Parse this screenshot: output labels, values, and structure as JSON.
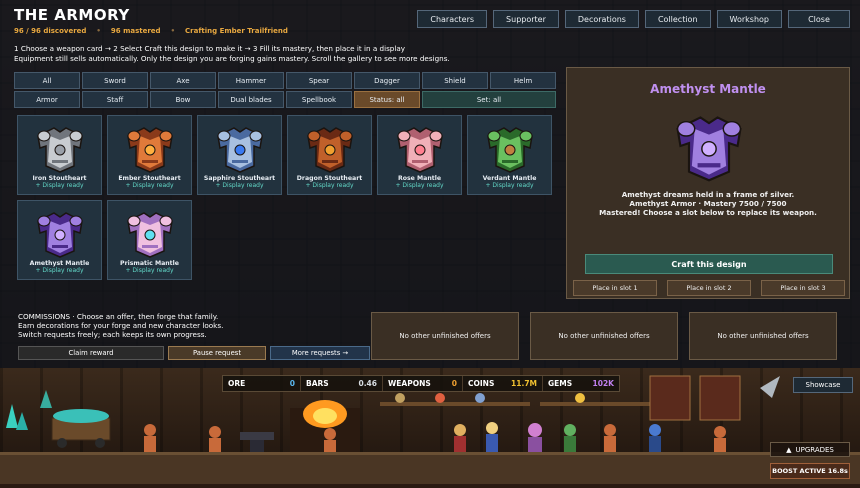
{
  "header": {
    "title": "THE ARMORY",
    "discovered": "96 / 96 discovered",
    "mastered": "96 mastered",
    "crafting": "Crafting Ember Trailfriend",
    "separator": "•"
  },
  "nav": [
    "Characters",
    "Supporter",
    "Decorations",
    "Collection",
    "Workshop",
    "Close"
  ],
  "instructions": {
    "line1": "1  Choose a weapon card      →      2  Select Craft this design to make it      →      3  Fill its mastery, then place it in a display",
    "line2": "Equipment still sells automatically. Only the design you are forging gains mastery. Scroll the gallery to see more designs."
  },
  "filters": {
    "row1": [
      "All",
      "Sword",
      "Axe",
      "Hammer",
      "Spear",
      "Dagger",
      "Shield",
      "Helm"
    ],
    "row2": [
      "Armor",
      "Staff",
      "Bow",
      "Dual blades",
      "Spellbook",
      "Status: all",
      "Set: all"
    ]
  },
  "cards": [
    {
      "name": "Iron Stoutheart",
      "status": "+ Display ready",
      "c1": "#c8ccd0",
      "c2": "#70757c",
      "gem": "#9aa0a8"
    },
    {
      "name": "Ember Stoutheart",
      "status": "+ Display ready",
      "c1": "#e07a3a",
      "c2": "#8a3a1a",
      "gem": "#ffb040"
    },
    {
      "name": "Sapphire Stoutheart",
      "status": "+ Display ready",
      "c1": "#a8c0e0",
      "c2": "#4a6aa0",
      "gem": "#3a7af0"
    },
    {
      "name": "Dragon Stoutheart",
      "status": "+ Display ready",
      "c1": "#c0602a",
      "c2": "#6a2a14",
      "gem": "#f0a030"
    },
    {
      "name": "Rose Mantle",
      "status": "+ Display ready",
      "c1": "#f0b0b8",
      "c2": "#b06070",
      "gem": "#ff8090"
    },
    {
      "name": "Verdant Mantle",
      "status": "+ Display ready",
      "c1": "#6ac060",
      "c2": "#2a6a2a",
      "gem": "#c08040"
    },
    {
      "name": "Amethyst Mantle",
      "status": "+ Display ready",
      "c1": "#a080e0",
      "c2": "#4a2a8a",
      "gem": "#d0b0ff"
    },
    {
      "name": "Prismatic Mantle",
      "status": "+ Display ready",
      "c1": "#f0c0e0",
      "c2": "#a070c0",
      "gem": "#60e0f0"
    }
  ],
  "detail": {
    "name": "Amethyst Mantle",
    "line1": "Amethyst dreams held in a frame of silver.",
    "line2": "Amethyst Armor · Mastery 7500 / 7500",
    "line3": "Mastered! Choose a slot below to replace its weapon.",
    "craft": "Craft this design",
    "slots": [
      "Place in slot 1",
      "Place in slot 2",
      "Place in slot 3"
    ]
  },
  "commissions": {
    "line1": "COMMISSIONS · Choose an offer, then forge that family.",
    "line2": "Earn decorations for your forge and new character looks.",
    "line3": "Switch requests freely; each keeps its own progress.",
    "claim": "Claim reward",
    "pause": "Pause request",
    "more": "More requests →",
    "offers": [
      "No other unfinished offers",
      "No other unfinished offers",
      "No other unfinished offers"
    ]
  },
  "resources": [
    {
      "label": "ORE",
      "value": "0",
      "color": "#5ab8f0"
    },
    {
      "label": "BARS",
      "value": "0.46",
      "color": "#d8dde2"
    },
    {
      "label": "WEAPONS",
      "value": "0",
      "color": "#f0a030"
    },
    {
      "label": "COINS",
      "value": "11.7M",
      "color": "#f0c030"
    },
    {
      "label": "GEMS",
      "value": "102K",
      "color": "#c080f0"
    }
  ],
  "showcase": "Showcase",
  "upgrades": "UPGRADES",
  "upgrades_icon": "▲",
  "boost": "BOOST ACTIVE  16.8s"
}
